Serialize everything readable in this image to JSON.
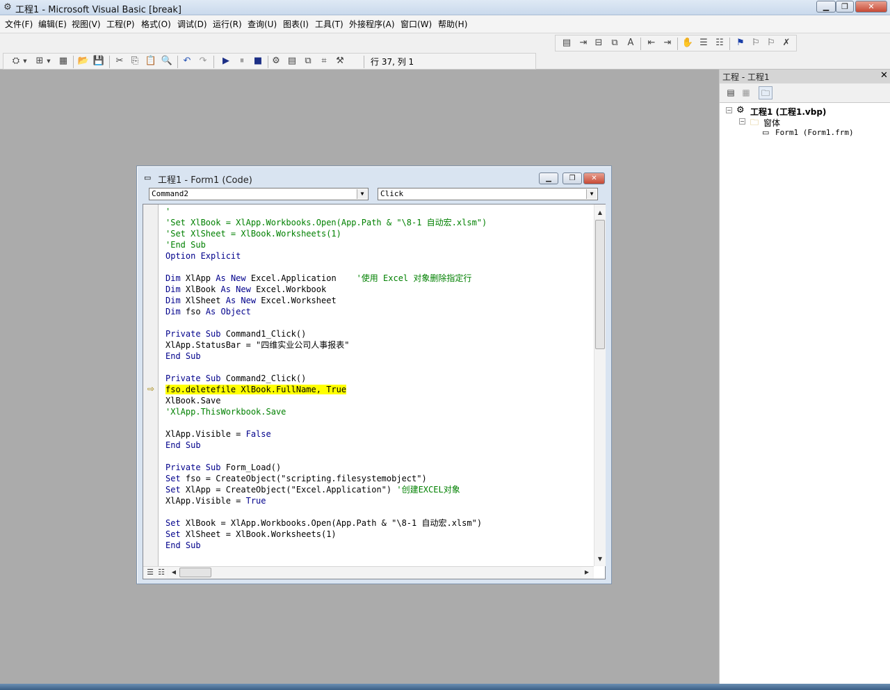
{
  "window": {
    "title": "工程1 - Microsoft Visual Basic [break]"
  },
  "menu": [
    {
      "label": "文件(F)"
    },
    {
      "label": "编辑(E)"
    },
    {
      "label": "视图(V)"
    },
    {
      "label": "工程(P)"
    },
    {
      "label": "格式(O)"
    },
    {
      "label": "调试(D)"
    },
    {
      "label": "运行(R)"
    },
    {
      "label": "查询(U)"
    },
    {
      "label": "图表(I)"
    },
    {
      "label": "工具(T)"
    },
    {
      "label": "外接程序(A)"
    },
    {
      "label": "窗口(W)"
    },
    {
      "label": "帮助(H)"
    }
  ],
  "toolbar": {
    "cursor_position": "行 37, 列 1"
  },
  "code_window": {
    "title": "工程1 - Form1 (Code)",
    "object_combo": "Command2",
    "procedure_combo": "Click"
  },
  "code_lines": [
    {
      "parts": [
        {
          "t": "'",
          "c": "cm"
        }
      ]
    },
    {
      "parts": [
        {
          "t": "'Set XlBook = XlApp.Workbooks.Open(App.Path & \"\\8-1 自动宏.xlsm\")",
          "c": "cm"
        }
      ]
    },
    {
      "parts": [
        {
          "t": "'Set XlSheet = XlBook.Worksheets(1)",
          "c": "cm"
        }
      ]
    },
    {
      "parts": [
        {
          "t": "'End Sub",
          "c": "cm"
        }
      ]
    },
    {
      "parts": [
        {
          "t": "Option Explicit",
          "c": "kw"
        }
      ]
    },
    {
      "parts": []
    },
    {
      "parts": [
        {
          "t": "Dim",
          "c": "kw"
        },
        {
          "t": " XlApp ",
          "c": "pl"
        },
        {
          "t": "As New",
          "c": "kw"
        },
        {
          "t": " Excel.Application    ",
          "c": "pl"
        },
        {
          "t": "'使用 Excel 对象删除指定行",
          "c": "cm"
        }
      ]
    },
    {
      "parts": [
        {
          "t": "Dim",
          "c": "kw"
        },
        {
          "t": " XlBook ",
          "c": "pl"
        },
        {
          "t": "As New",
          "c": "kw"
        },
        {
          "t": " Excel.Workbook",
          "c": "pl"
        }
      ]
    },
    {
      "parts": [
        {
          "t": "Dim",
          "c": "kw"
        },
        {
          "t": " XlSheet ",
          "c": "pl"
        },
        {
          "t": "As New",
          "c": "kw"
        },
        {
          "t": " Excel.Worksheet",
          "c": "pl"
        }
      ]
    },
    {
      "parts": [
        {
          "t": "Dim",
          "c": "kw"
        },
        {
          "t": " fso ",
          "c": "pl"
        },
        {
          "t": "As Object",
          "c": "kw"
        }
      ]
    },
    {
      "parts": []
    },
    {
      "parts": [
        {
          "t": "Private Sub",
          "c": "kw"
        },
        {
          "t": " Command1_Click()",
          "c": "pl"
        }
      ]
    },
    {
      "parts": [
        {
          "t": "XlApp.StatusBar = \"四维实业公司人事报表\"",
          "c": "pl"
        }
      ]
    },
    {
      "parts": [
        {
          "t": "End Sub",
          "c": "kw"
        }
      ]
    },
    {
      "parts": []
    },
    {
      "parts": [
        {
          "t": "Private Sub",
          "c": "kw"
        },
        {
          "t": " Command2_Click()",
          "c": "pl"
        }
      ]
    },
    {
      "parts": [
        {
          "t": "fso.deletefile XlBook.FullName, True",
          "c": "pl"
        }
      ],
      "highlight": true
    },
    {
      "parts": [
        {
          "t": "XlBook.Save",
          "c": "pl"
        }
      ]
    },
    {
      "parts": [
        {
          "t": "'XlApp.ThisWorkbook.Save",
          "c": "cm"
        }
      ]
    },
    {
      "parts": []
    },
    {
      "parts": [
        {
          "t": "XlApp.Visible = ",
          "c": "pl"
        },
        {
          "t": "False",
          "c": "kw"
        }
      ]
    },
    {
      "parts": [
        {
          "t": "End Sub",
          "c": "kw"
        }
      ]
    },
    {
      "parts": []
    },
    {
      "parts": [
        {
          "t": "Private Sub",
          "c": "kw"
        },
        {
          "t": " Form_Load()",
          "c": "pl"
        }
      ]
    },
    {
      "parts": [
        {
          "t": "Set",
          "c": "kw"
        },
        {
          "t": " fso = CreateObject(\"scripting.filesystemobject\")",
          "c": "pl"
        }
      ]
    },
    {
      "parts": [
        {
          "t": "Set",
          "c": "kw"
        },
        {
          "t": " XlApp = CreateObject(\"Excel.Application\") ",
          "c": "pl"
        },
        {
          "t": "'创建EXCEL对象",
          "c": "cm"
        }
      ]
    },
    {
      "parts": [
        {
          "t": "XlApp.Visible = ",
          "c": "pl"
        },
        {
          "t": "True",
          "c": "kw"
        }
      ]
    },
    {
      "parts": []
    },
    {
      "parts": [
        {
          "t": "Set",
          "c": "kw"
        },
        {
          "t": " XlBook = XlApp.Workbooks.Open(App.Path & \"\\8-1 自动宏.xlsm\")",
          "c": "pl"
        }
      ]
    },
    {
      "parts": [
        {
          "t": "Set",
          "c": "kw"
        },
        {
          "t": " XlSheet = XlBook.Worksheets(1)",
          "c": "pl"
        }
      ]
    },
    {
      "parts": [
        {
          "t": "End Sub",
          "c": "kw"
        }
      ]
    }
  ],
  "project": {
    "title": "工程 - 工程1",
    "root": "工程1 (工程1.vbp)",
    "folder": "窗体",
    "file": "Form1 (Form1.frm)"
  }
}
